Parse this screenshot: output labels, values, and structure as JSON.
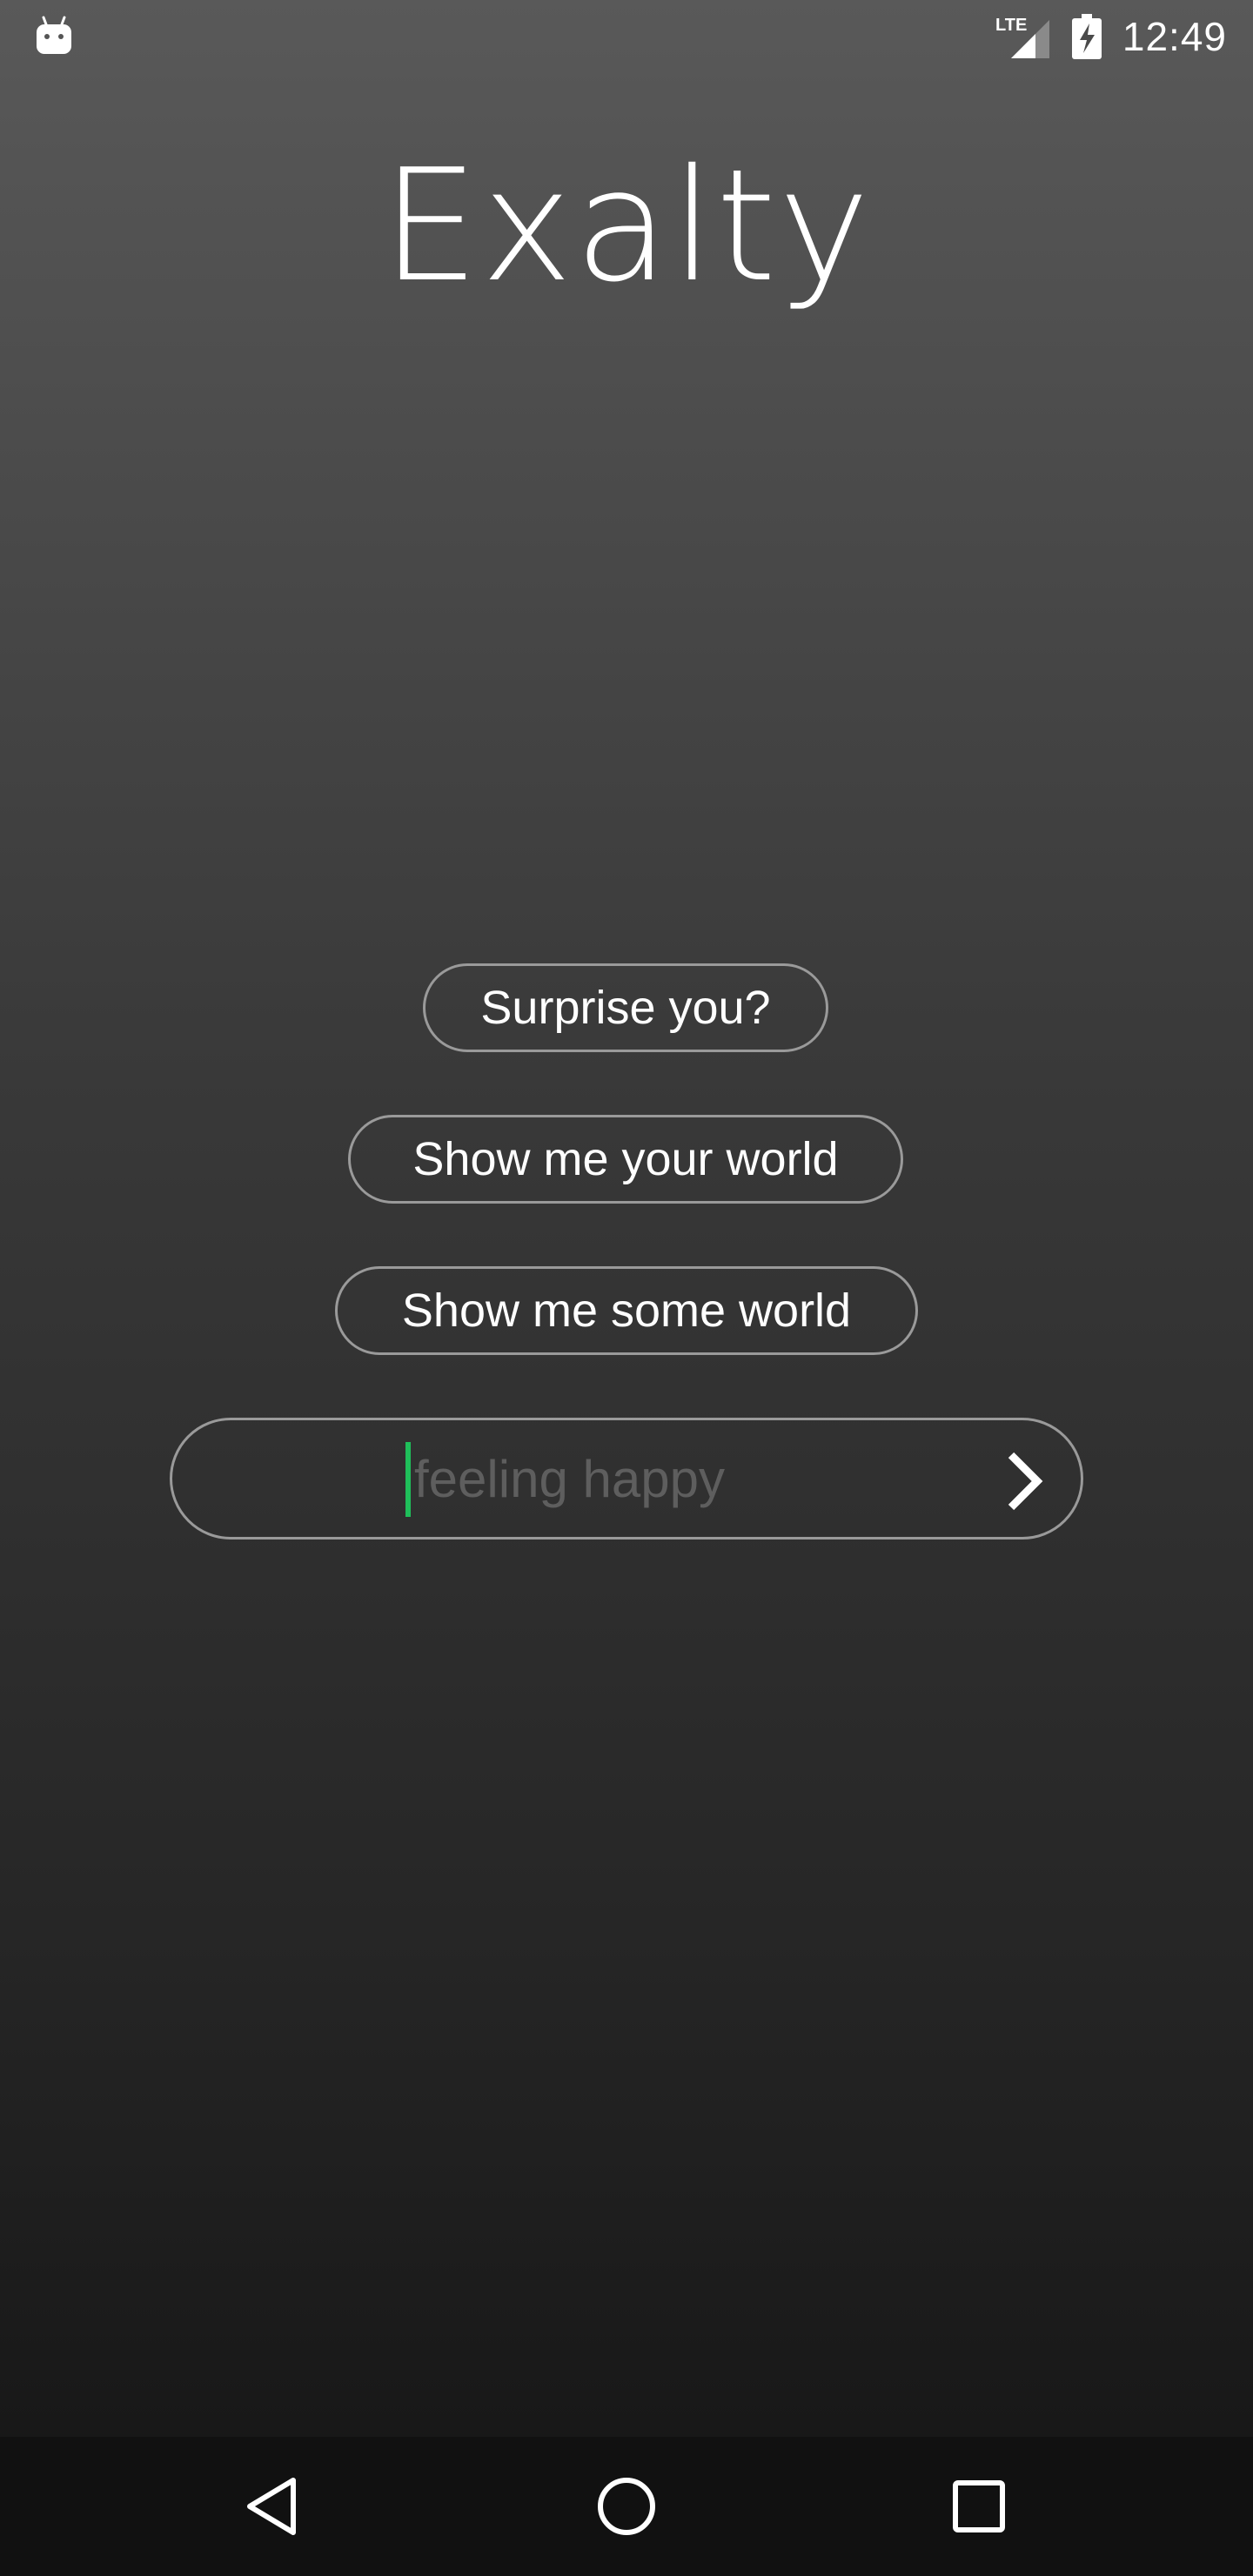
{
  "status_bar": {
    "time": "12:49",
    "network_label": "LTE",
    "icons": [
      "android-icon",
      "lte-signal-icon",
      "battery-charging-icon"
    ]
  },
  "app": {
    "title": "Exalty"
  },
  "buttons": {
    "surprise_label": "Surprise you?",
    "your_world_label": "Show me your world",
    "some_world_label": "Show me some world"
  },
  "search": {
    "placeholder": "feeling happy",
    "value": "",
    "submit_icon": "chevron-right-icon"
  },
  "nav_bar": {
    "icons": [
      "back-icon",
      "home-icon",
      "recents-icon"
    ]
  },
  "colors": {
    "background_top": "#595959",
    "background_bottom": "#141414",
    "border": "#9a9a9a",
    "caret": "#1fbf5a",
    "placeholder": "#5e5e5e"
  }
}
